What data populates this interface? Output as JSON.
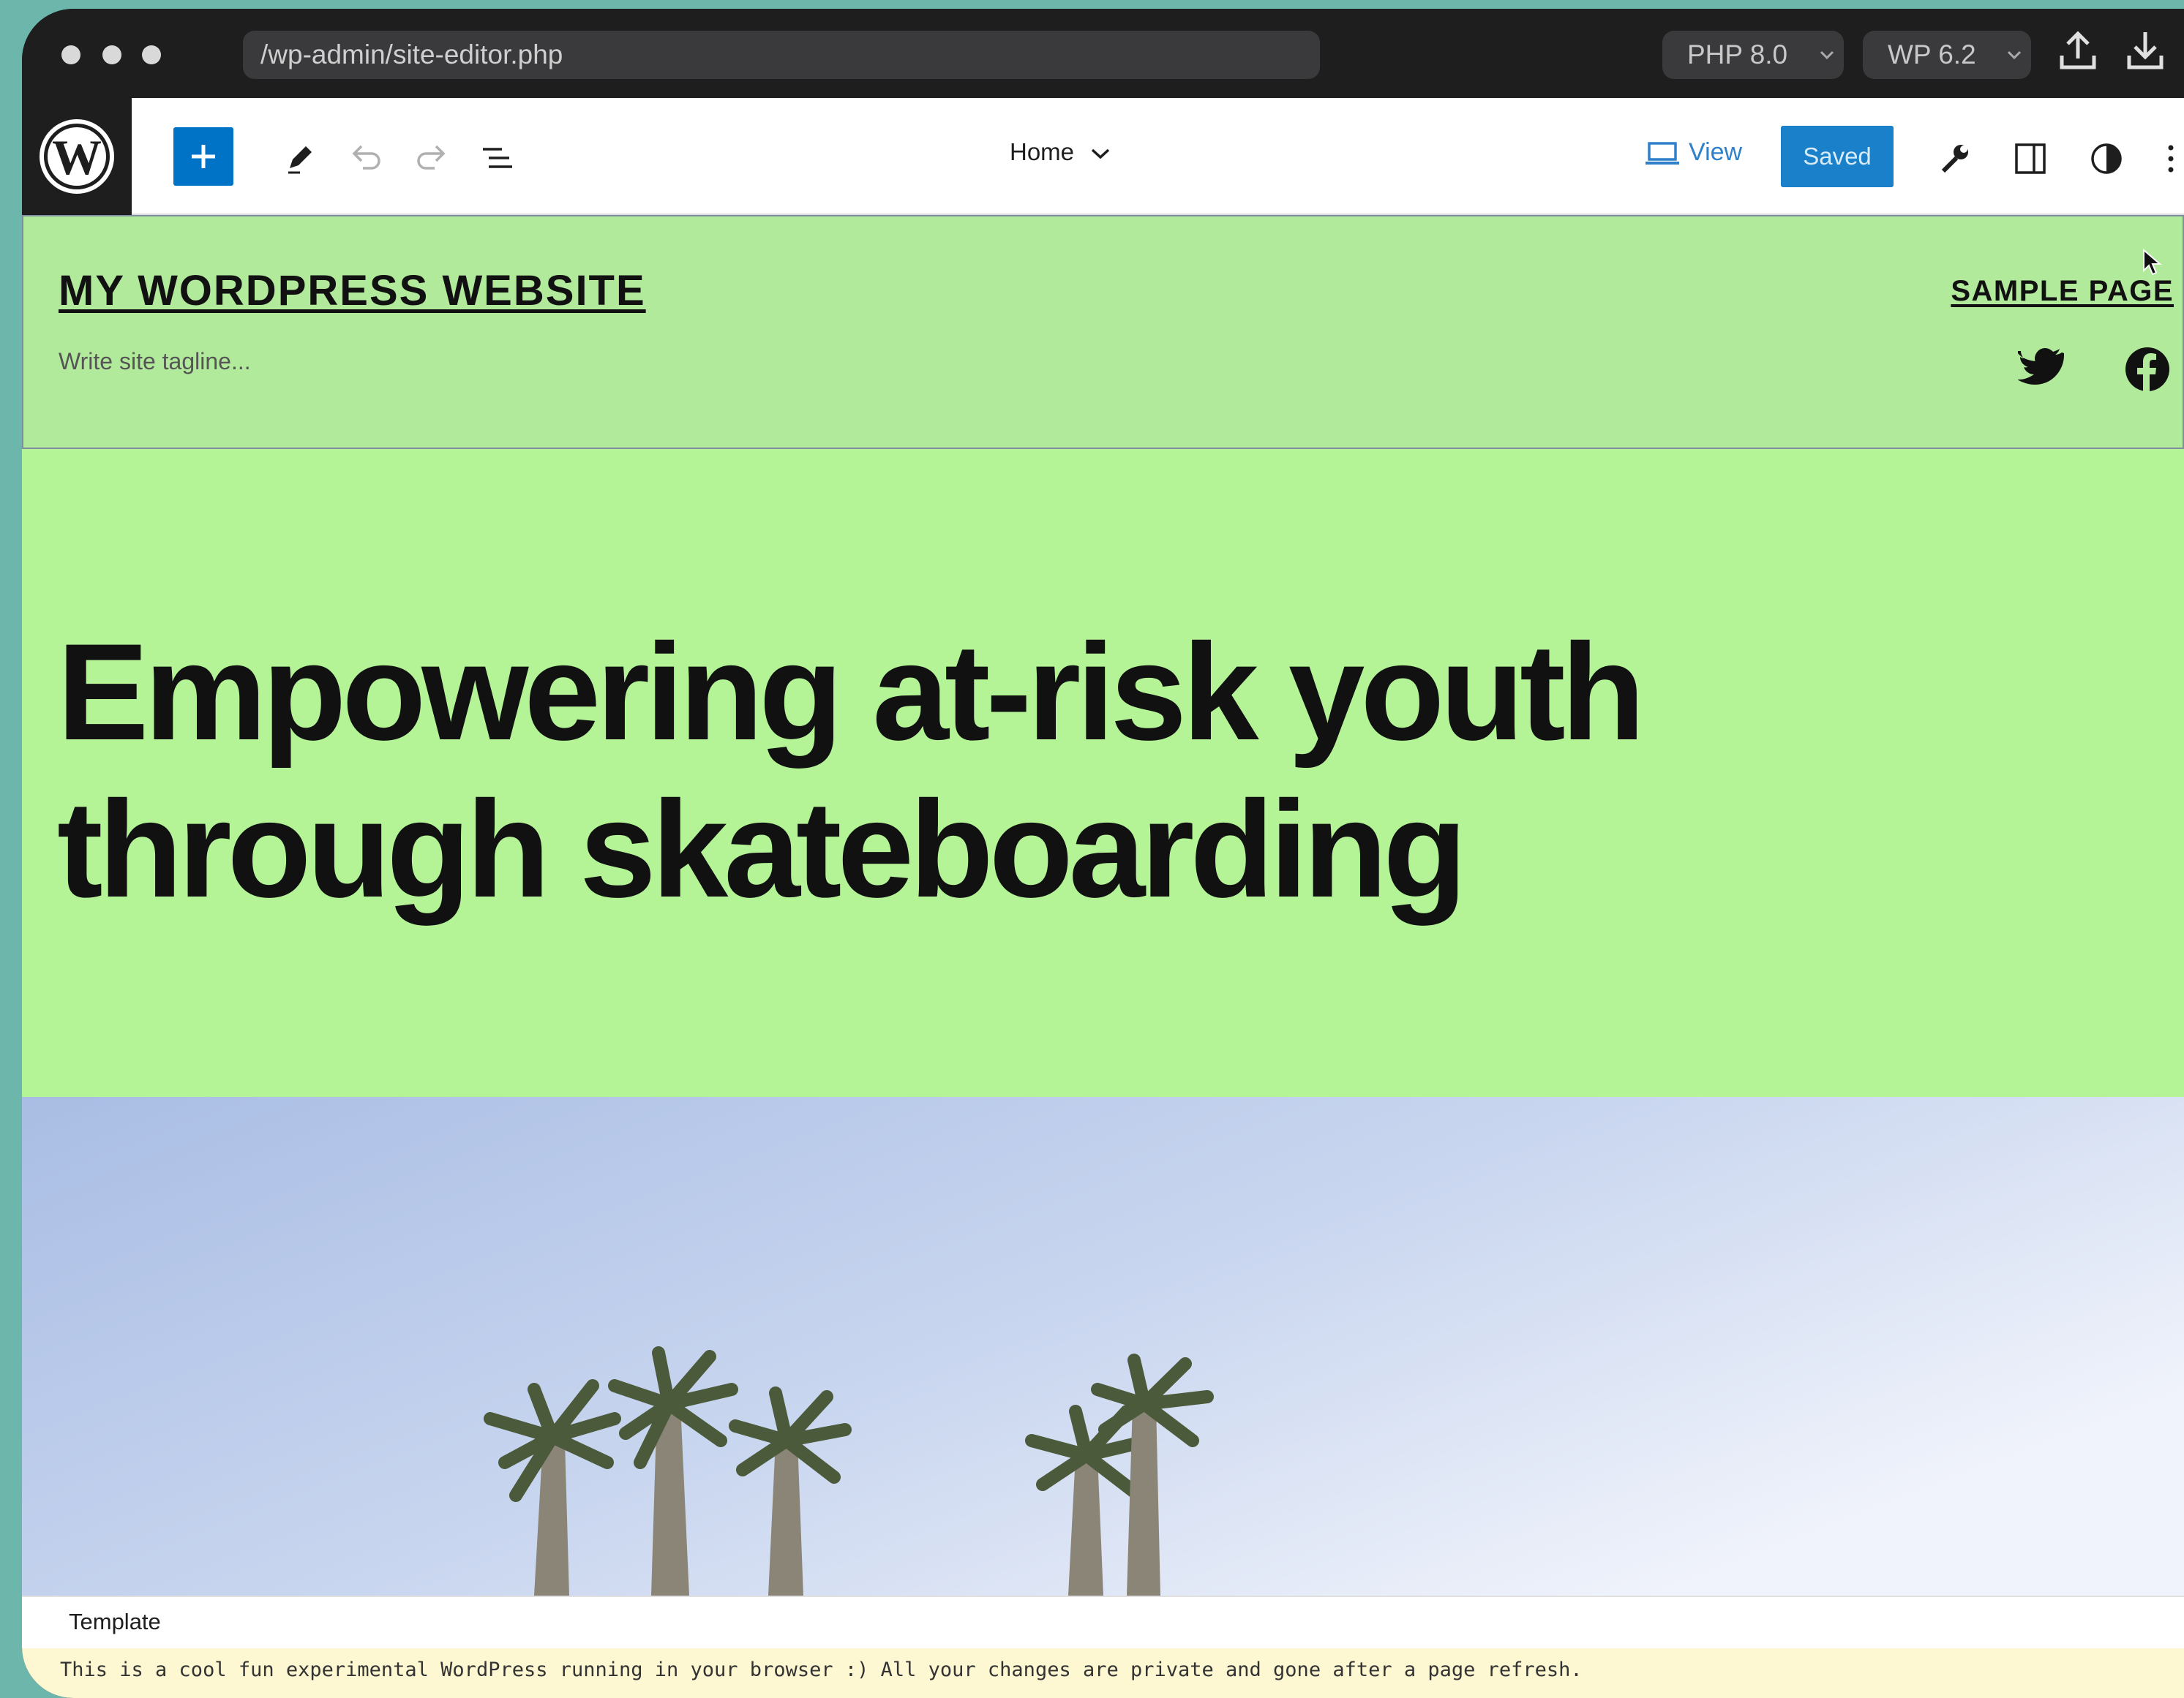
{
  "browser": {
    "url": "/wp-admin/site-editor.php",
    "php_version": "PHP 8.0",
    "wp_version": "WP 6.2"
  },
  "toolbar": {
    "template_selector": "Home",
    "view_label": "View",
    "save_label": "Saved"
  },
  "site_header": {
    "title": "MY WORDPRESS WEBSITE",
    "tagline_placeholder": "Write site tagline...",
    "nav_items": [
      "SAMPLE PAGE"
    ],
    "social_icons": [
      "twitter-icon",
      "facebook-icon"
    ]
  },
  "hero": {
    "heading_lines": [
      "Empowering at-risk youth",
      "through skateboarding"
    ]
  },
  "footer_bar": {
    "breadcrumb": "Template"
  },
  "notice": {
    "text": "This is a cool fun experimental WordPress running in your browser :) All your changes are private and gone after a page refresh."
  },
  "colors": {
    "accent": "#0073c6",
    "header_bg": "#b2ea9c",
    "hero_bg": "#b4f497",
    "notice_bg": "#fdf7d2"
  }
}
